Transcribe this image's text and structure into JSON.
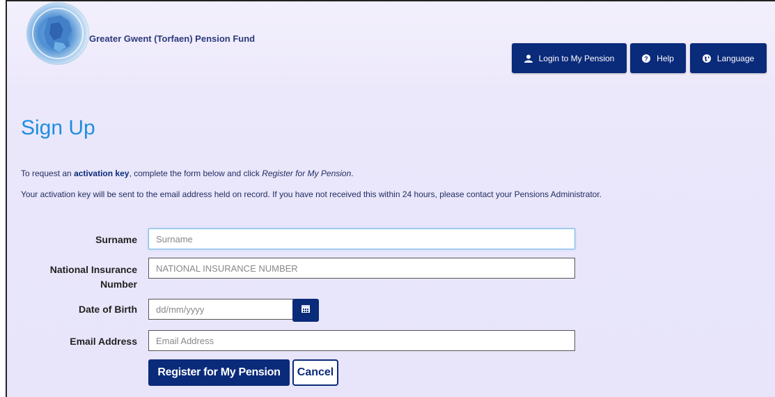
{
  "header": {
    "org_name": "Greater Gwent (Torfaen) Pension Fund",
    "login_label": "Login to My Pension",
    "help_label": "Help",
    "language_label": "Language"
  },
  "page": {
    "title": "Sign Up",
    "intro_prefix": "To request an ",
    "intro_bold": "activation key",
    "intro_middle": ", complete the form below and click ",
    "intro_italic": "Register for My Pension",
    "intro_suffix": ".",
    "info": "Your activation key will be sent to the email address held on record. If you have not received this within 24 hours, please contact your Pensions Administrator."
  },
  "form": {
    "surname": {
      "label": "Surname",
      "placeholder": "Surname",
      "value": ""
    },
    "ni": {
      "label_line1": "National Insurance",
      "label_line2": "Number",
      "placeholder": "NATIONAL INSURANCE NUMBER",
      "value": ""
    },
    "dob": {
      "label": "Date of Birth",
      "placeholder": "dd/mm/yyyy",
      "value": ""
    },
    "email": {
      "label": "Email Address",
      "placeholder": "Email Address",
      "value": ""
    },
    "submit_label": "Register for My Pension",
    "cancel_label": "Cancel"
  },
  "icons": {
    "login": "user-icon",
    "help": "question-circle-icon",
    "language": "globe-icon",
    "calendar": "calendar-icon"
  },
  "colors": {
    "brand_navy": "#0a2a7a",
    "title_blue": "#1f8ee0",
    "background": "#ebe8fb"
  }
}
